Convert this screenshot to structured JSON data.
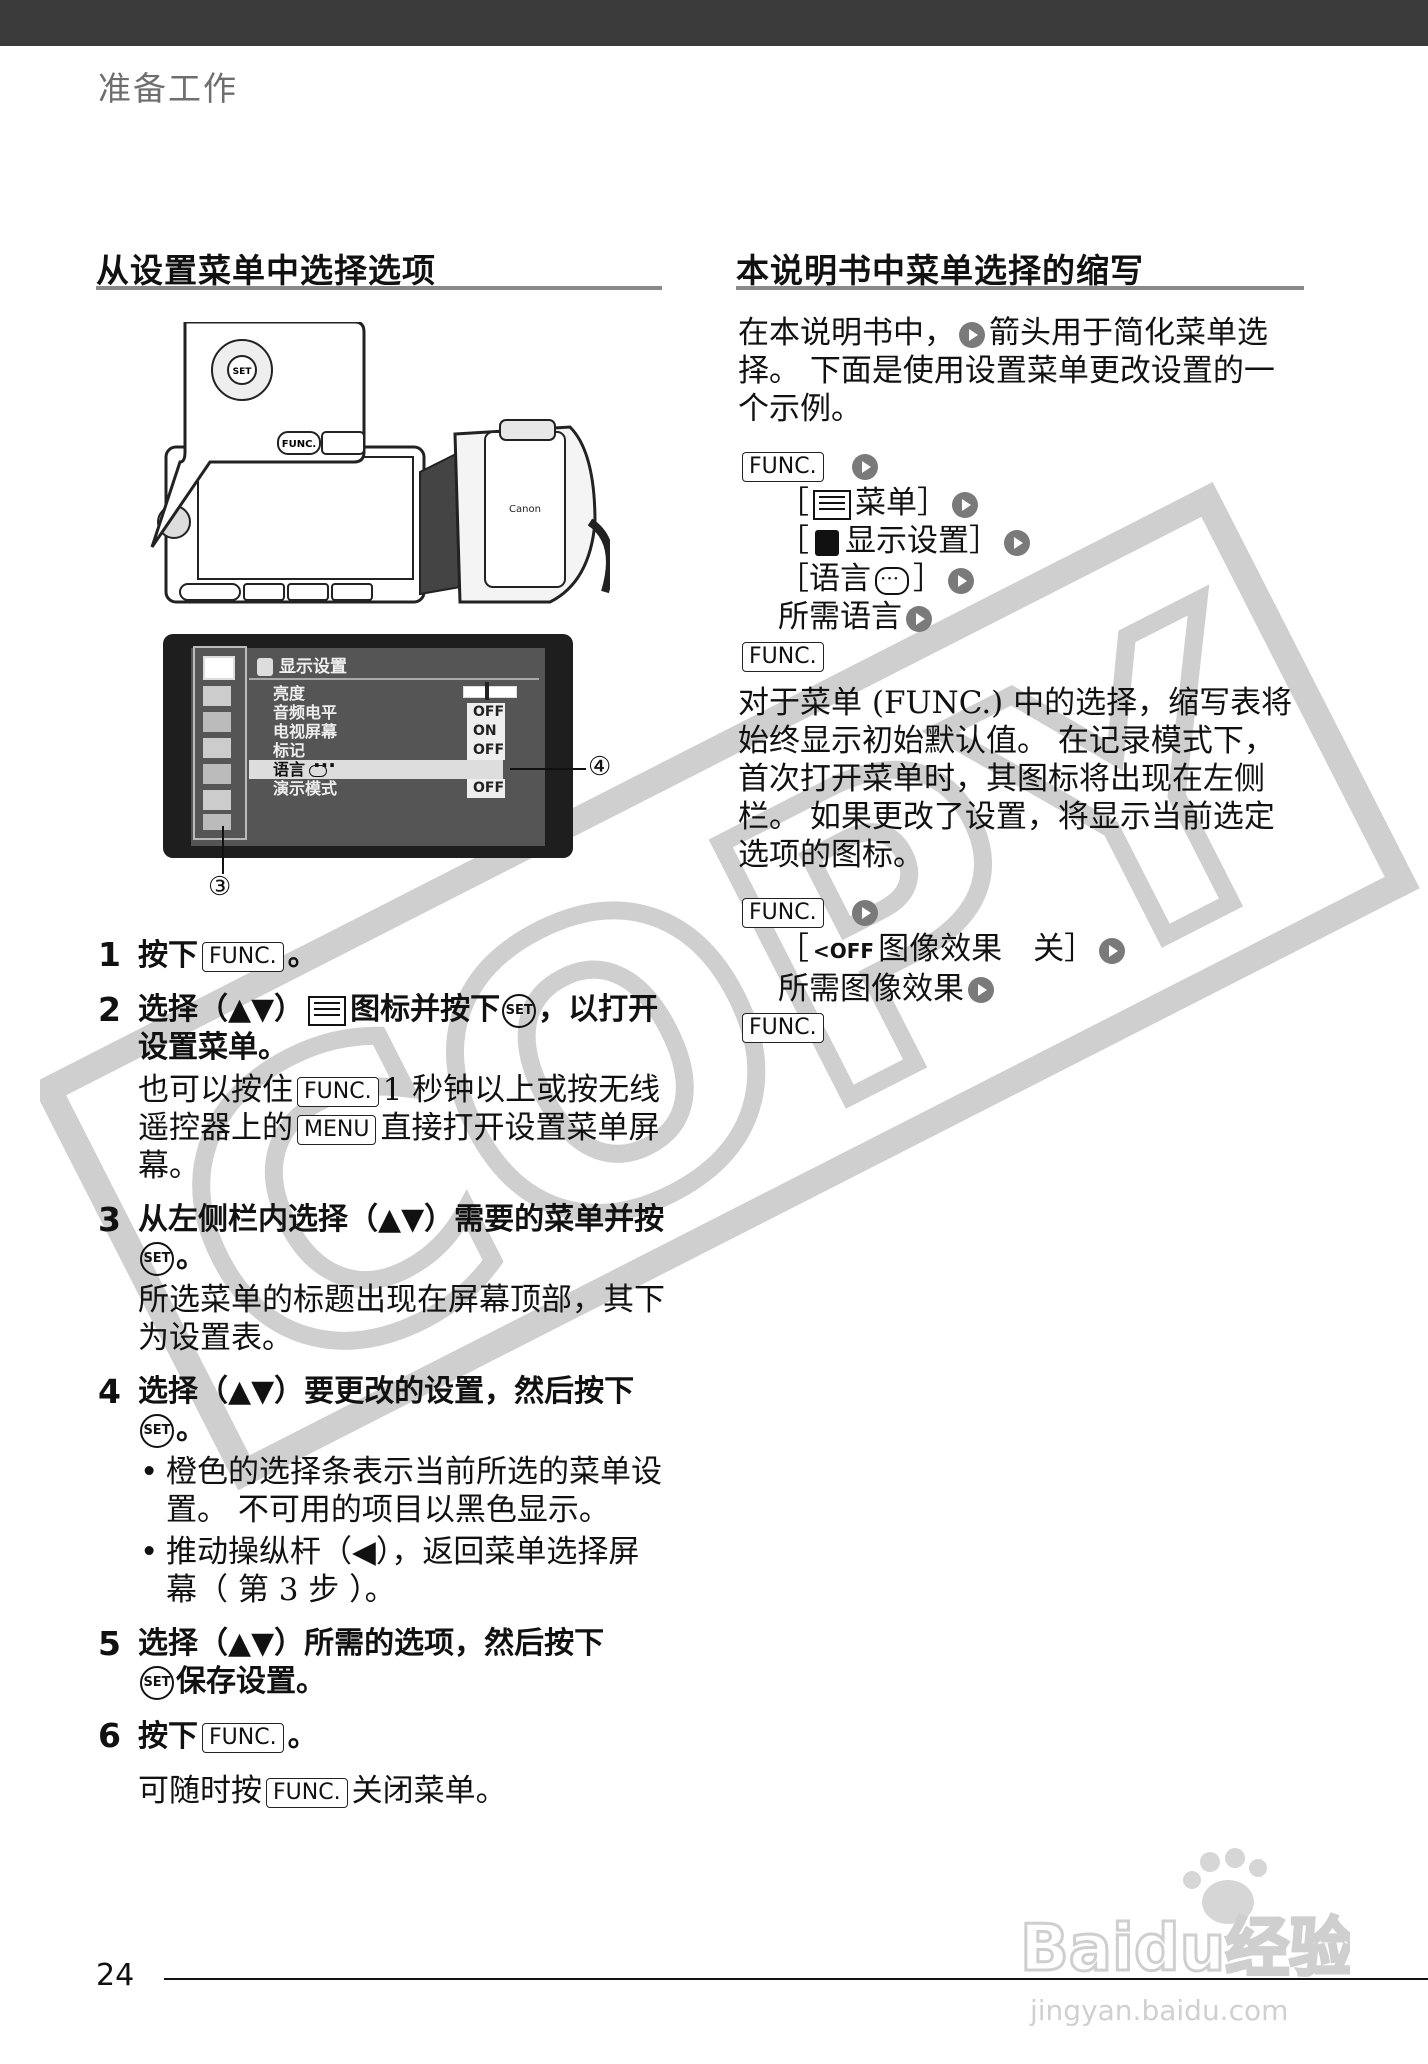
{
  "header": {
    "section_label": "准备工作"
  },
  "left": {
    "title": "从设置菜单中选择选项",
    "camera": {
      "brand": "Canon",
      "func_label": "FUNC.",
      "set_label": "SET"
    },
    "menu_screen": {
      "header": "显示设置",
      "items": [
        {
          "label": "亮度",
          "value": ""
        },
        {
          "label": "音频电平",
          "value": "OFF"
        },
        {
          "label": "电视屏幕",
          "value": "ON"
        },
        {
          "label": "标记",
          "value": "OFF"
        },
        {
          "label": "语言",
          "value": ""
        },
        {
          "label": "演示模式",
          "value": "OFF"
        }
      ],
      "callout_right": "④",
      "callout_bottom": "③"
    },
    "steps": [
      {
        "num": "1",
        "pre": "按下",
        "key": "FUNC.",
        "post": "。"
      },
      {
        "num": "2",
        "title_a": "选择（▲▼）",
        "title_b": "图标并按下",
        "title_c": "，以打开设置菜单。",
        "body_a": "也可以按住",
        "key1": "FUNC.",
        "body_b": "1 秒钟以上或按无线遥控器上的",
        "key2": "MENU",
        "body_c": "直接打开设置菜单屏幕。"
      },
      {
        "num": "3",
        "title_a": "从左侧栏内选择（▲▼）需要的菜单并按",
        "title_b": "。",
        "body": "所选菜单的标题出现在屏幕顶部，其下为设置表。"
      },
      {
        "num": "4",
        "title_a": "选择（▲▼）要更改的设置，然后按下",
        "title_b": "。",
        "bullets": [
          "橙色的选择条表示当前所选的菜单设置。 不可用的项目以黑色显示。",
          "推动操纵杆（◀），返回菜单选择屏幕（ 第 3 步 ）。"
        ]
      },
      {
        "num": "5",
        "title_a": "选择（▲▼）所需的选项，然后按下",
        "title_b": "保存设置。"
      },
      {
        "num": "6",
        "pre": "按下",
        "key": "FUNC.",
        "post": "。",
        "body_a": "可随时按",
        "key_b": "FUNC.",
        "body_b": "关闭菜单。"
      }
    ]
  },
  "right": {
    "title": "本说明书中菜单选择的缩写",
    "intro_a": "在本说明书中，",
    "intro_b": "箭头用于简化菜单选择。 下面是使用设置菜单更改设置的一个示例。",
    "example1": {
      "func": "FUNC.",
      "line1_a": "［",
      "line1_b": "菜单］",
      "line2_a": "［",
      "line2_b": "显示设置］",
      "line3_a": "［语言",
      "line3_b": "］",
      "line4": "所需语言"
    },
    "para2": "对于菜单 (FUNC.) 中的选择，缩写表将始终显示初始默认值。 在记录模式下，首次打开菜单时，其图标将出现在左侧栏。 如果更改了设置，将显示当前选定选项的图标。",
    "example2": {
      "func": "FUNC.",
      "off_icon": "OFF",
      "line1_a": "［",
      "line1_b": "图像效果　关］",
      "line2": "所需图像效果"
    },
    "watermark": "COPY"
  },
  "footer": {
    "page_number": "24",
    "baidu_logo": "Baidu经验",
    "baidu_url": "jingyan.baidu.com"
  }
}
